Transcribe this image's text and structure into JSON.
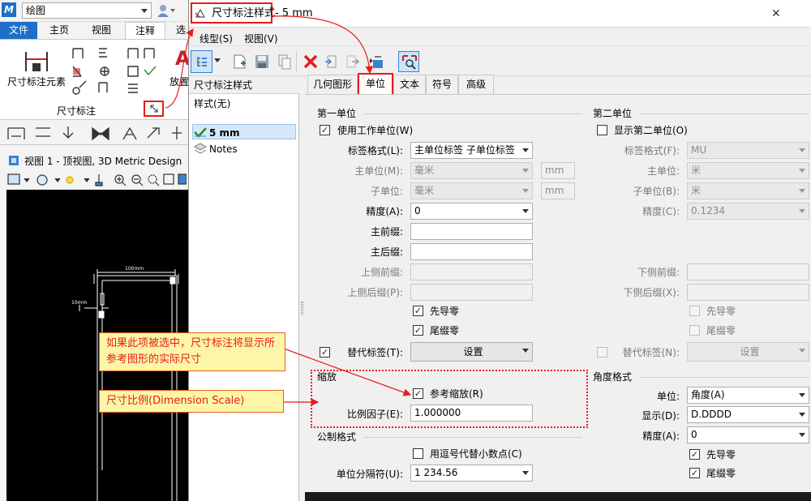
{
  "left_app": {
    "logo": "M",
    "workflow": "绘图",
    "ribbon_tabs": [
      "文件",
      "主页",
      "视图",
      "注释",
      "选"
    ],
    "ribbon_active_tab": "注释",
    "dim_element_label": "尺寸标注元素",
    "place_label": "放置",
    "group_label": "尺寸标注",
    "view_title": "视图 1 - 顶视图, 3D Metric Design",
    "drawing_dims": [
      "100mm",
      "10mm"
    ]
  },
  "dialog": {
    "title": "尺寸标注样式",
    "title_suffix": "-  5 mm",
    "close_glyph": "✕",
    "menus": [
      "线型(S)",
      "视图(V)"
    ],
    "tree": {
      "header": "尺寸标注样式",
      "root": "样式(无)",
      "items": [
        {
          "label": "5 mm",
          "selected": true
        },
        {
          "label": "Notes",
          "selected": false
        }
      ]
    },
    "tabs": [
      "几何图形",
      "单位",
      "文本",
      "符号",
      "高级"
    ],
    "active_tab": "单位",
    "primary": {
      "section": "第一单位",
      "use_working_units": "使用工作单位(W)",
      "label_format_label": "标签格式(L):",
      "label_format_value": "主单位标签 子单位标签",
      "master_unit_label": "主单位(M):",
      "master_unit_value": "毫米",
      "master_unit_suffix": "mm",
      "sub_unit_label": "子单位:",
      "sub_unit_value": "毫米",
      "sub_unit_suffix": "mm",
      "accuracy_label": "精度(A):",
      "accuracy_value": "0",
      "main_prefix_label": "主前缀:",
      "main_suffix_label": "主后缀:",
      "upper_prefix_label": "上侧前缀:",
      "upper_suffix_label": "上侧后缀(P):",
      "leading_zero": "先导零",
      "trailing_zero": "尾缀零",
      "alt_label": "替代标签(T):",
      "alt_button": "设置"
    },
    "secondary": {
      "section": "第二单位",
      "show_secondary": "显示第二单位(O)",
      "label_format_label": "标签格式(F):",
      "label_format_value": "MU",
      "master_unit_label": "主单位:",
      "master_unit_value": "米",
      "sub_unit_label": "子单位(B):",
      "sub_unit_value": "米",
      "accuracy_label": "精度(C):",
      "accuracy_value": "0.1234",
      "lower_prefix_label": "下侧前缀:",
      "lower_suffix_label": "下侧后缀(X):",
      "leading_zero": "先导零",
      "trailing_zero": "尾缀零",
      "alt_label": "替代标签(N):",
      "alt_button": "设置"
    },
    "scale": {
      "section": "缩放",
      "reference_scale": "参考缩放(R)",
      "scale_factor_label": "比例因子(E):",
      "scale_factor_value": "1.000000"
    },
    "tolerance": {
      "section": "公制格式",
      "comma_decimal": "用逗号代替小数点(C)",
      "separator_label": "单位分隔符(U):",
      "separator_value": "1 234.56"
    },
    "angle": {
      "section": "角度格式",
      "unit_label": "单位:",
      "unit_value": "角度(A)",
      "display_label": "显示(D):",
      "display_value": "D.DDDD",
      "accuracy_label": "精度(A):",
      "accuracy_value": "0",
      "leading_zero": "先导零",
      "trailing_zero": "尾缀零"
    }
  },
  "annotations": {
    "callout_1": "如果此项被选中，尺寸标注将显示所参考图形的实际尺寸",
    "callout_2": "尺寸比例(Dimension Scale)"
  },
  "colors": {
    "ribbon_blue": "#1e6fc8",
    "highlight_red": "#e81b1b",
    "callout_bg": "#fdf5a8"
  }
}
